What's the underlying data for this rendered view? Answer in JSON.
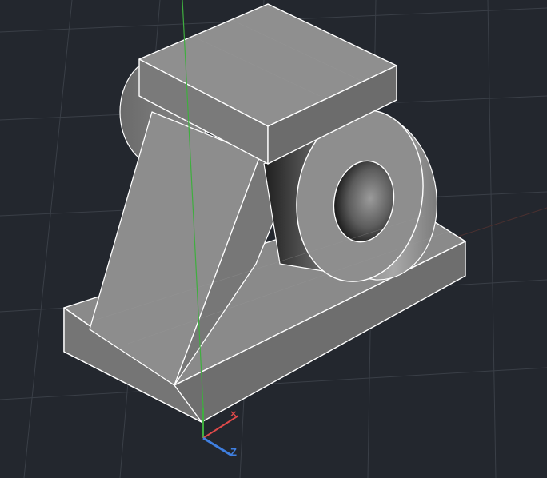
{
  "viewport": {
    "background": "#23272e",
    "grid_color": "#3a3f47",
    "edge_color": "#ffffff"
  },
  "model": {
    "name": "",
    "face_colors": {
      "top_light": "#8f8f8f",
      "front": "#7a7a7a",
      "side": "#6a6a6a",
      "bore_dark": "#2a2a2a"
    }
  },
  "axes": {
    "x_color": "#e04a4a",
    "y_color": "#3fae3f",
    "z_color": "#3f7fe0",
    "z_label": "Z"
  },
  "icons": {
    "ucs": "ucs-axis-icon"
  }
}
